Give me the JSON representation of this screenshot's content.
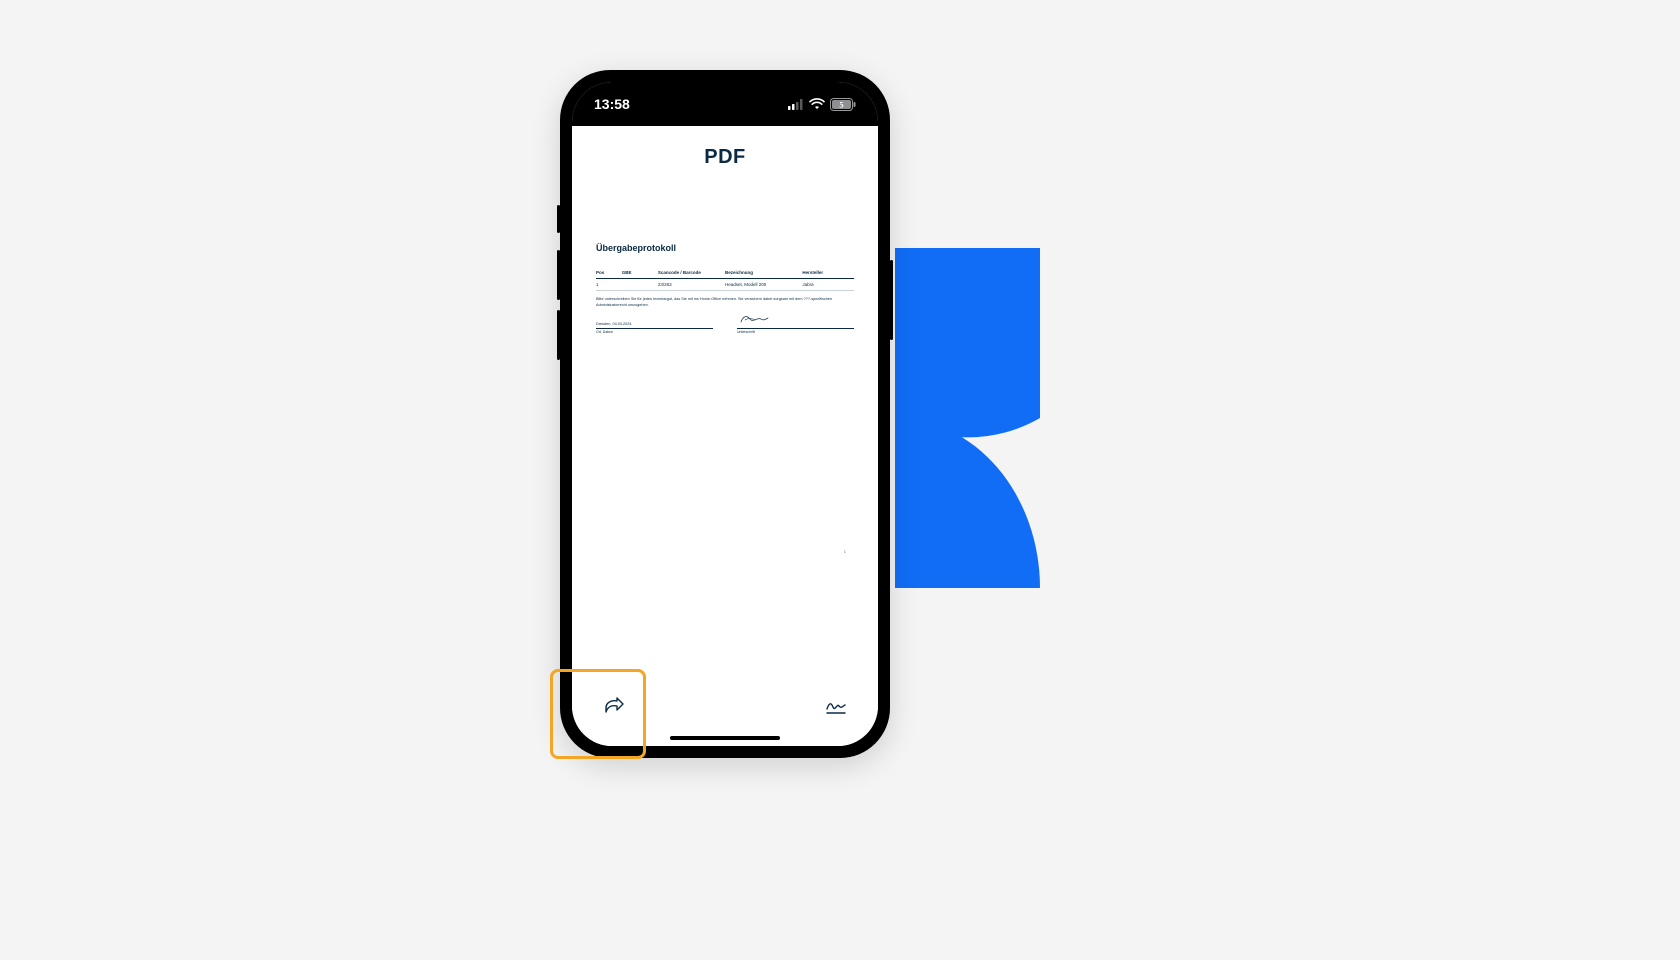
{
  "status_bar": {
    "time": "13:58",
    "battery_level": "5"
  },
  "app": {
    "title": "PDF"
  },
  "document": {
    "title": "Übergabeprotokoll",
    "columns": {
      "pos": "Pos",
      "gbe": "GBE",
      "scancode": "Scancode / Barcode",
      "bezeichnung": "Bezeichnung",
      "hersteller": "Hersteller"
    },
    "row": {
      "pos": "1",
      "gbe": "",
      "scancode": "23/263",
      "bezeichnung": "Headset, Modell 200",
      "hersteller": "Jabra"
    },
    "note": "Bitte unterschreiben Sie für jedes Inventargut, das Sie mit ins Home-Office nehmen. Sie versichern dabei sorgsam mit dem ???-spezifischen Administratorrecht umzugehen.",
    "sig_left_value": "Dresden, 04.03.2024",
    "sig_left_label": "Ort, Datum",
    "sig_right_label": "Unterschrift",
    "page_number": "1"
  },
  "toolbar": {
    "share_label": "share",
    "sign_label": "sign"
  },
  "colors": {
    "brand_blue": "#116df6",
    "highlight": "#f3a623",
    "ink": "#0a2a43"
  }
}
